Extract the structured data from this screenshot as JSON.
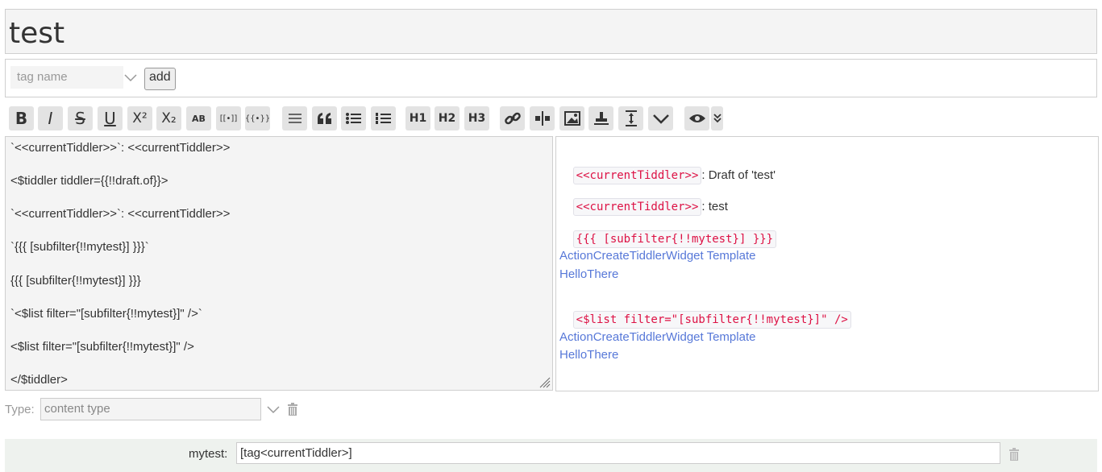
{
  "title": "test",
  "tags": {
    "placeholder": "tag name",
    "add_label": "add"
  },
  "toolbar": {
    "bold": "B",
    "italic": "I",
    "strike": "S",
    "underline": "U",
    "superscript": "X²",
    "subscript": "X₂",
    "smallcaps": "AB",
    "wikilink": "[[•]]",
    "transclude": "{{•}}",
    "h1": "H1",
    "h2": "H2",
    "h3": "H3"
  },
  "toolbar_icons": [
    "bold",
    "italic",
    "strikethrough",
    "underline",
    "superscript",
    "subscript",
    "smallcaps",
    "wikilink",
    "transclude",
    "mono-block",
    "quote",
    "bullet-list",
    "numbered-list",
    "heading-1",
    "heading-2",
    "heading-3",
    "link",
    "excise",
    "picture",
    "stamp",
    "size",
    "more",
    "preview",
    "preview-type"
  ],
  "editor_lines": [
    "`<<currentTiddler>>`: <<currentTiddler>>",
    "<$tiddler tiddler={{!!draft.of}}>",
    "`<<currentTiddler>>`: <<currentTiddler>>",
    "`{{{ [subfilter{!!mytest}] }}}`",
    "{{{ [subfilter{!!mytest}] }}}",
    "`<$list filter=\"[subfilter{!!mytest}]\" />`",
    "<$list filter=\"[subfilter{!!mytest}]\" />",
    "</$tiddler>"
  ],
  "preview": {
    "line1_code": "<<currentTiddler>>",
    "line1_text": ": Draft of 'test'",
    "line2_code": "<<currentTiddler>>",
    "line2_text": ": test",
    "line3_code": "{{{ [subfilter{!!mytest}] }}}",
    "links1": [
      "ActionCreateTiddlerWidget Template",
      "HelloThere"
    ],
    "line4_code": "<$list filter=\"[subfilter{!!mytest}]\" />",
    "links2": [
      "ActionCreateTiddlerWidget Template",
      "HelloThere"
    ]
  },
  "type": {
    "label": "Type:",
    "placeholder": "content type"
  },
  "field": {
    "name": "mytest:",
    "value": "[tag<currentTiddler>]"
  },
  "colors": {
    "link": "#5778d8",
    "code": "#dd1144",
    "field_bg": "#eef2ee"
  }
}
